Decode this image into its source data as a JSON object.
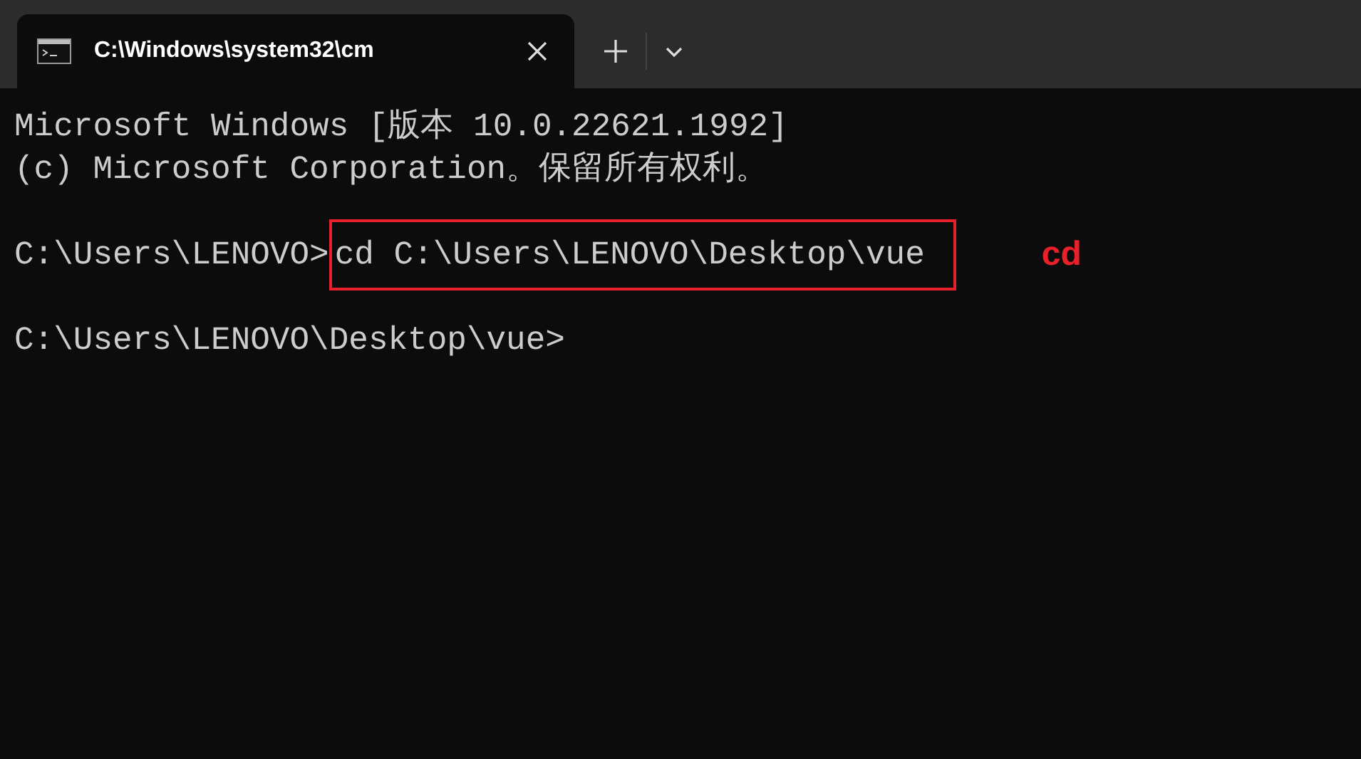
{
  "tabs": [
    {
      "title": "C:\\Windows\\system32\\cm",
      "selected": true
    }
  ],
  "lines": [
    {
      "kind": "output",
      "text": "Microsoft Windows [版本 10.0.22621.1992]"
    },
    {
      "kind": "output",
      "text": "(c) Microsoft Corporation。保留所有权利。"
    },
    {
      "kind": "blank"
    },
    {
      "kind": "command",
      "prompt": "C:\\Users\\LENOVO>",
      "command": "cd C:\\Users\\LENOVO\\Desktop\\vue",
      "highlighted": true
    },
    {
      "kind": "blank"
    },
    {
      "kind": "prompt",
      "prompt": "C:\\Users\\LENOVO\\Desktop\\vue>"
    }
  ],
  "annotation": {
    "text": "cd"
  }
}
